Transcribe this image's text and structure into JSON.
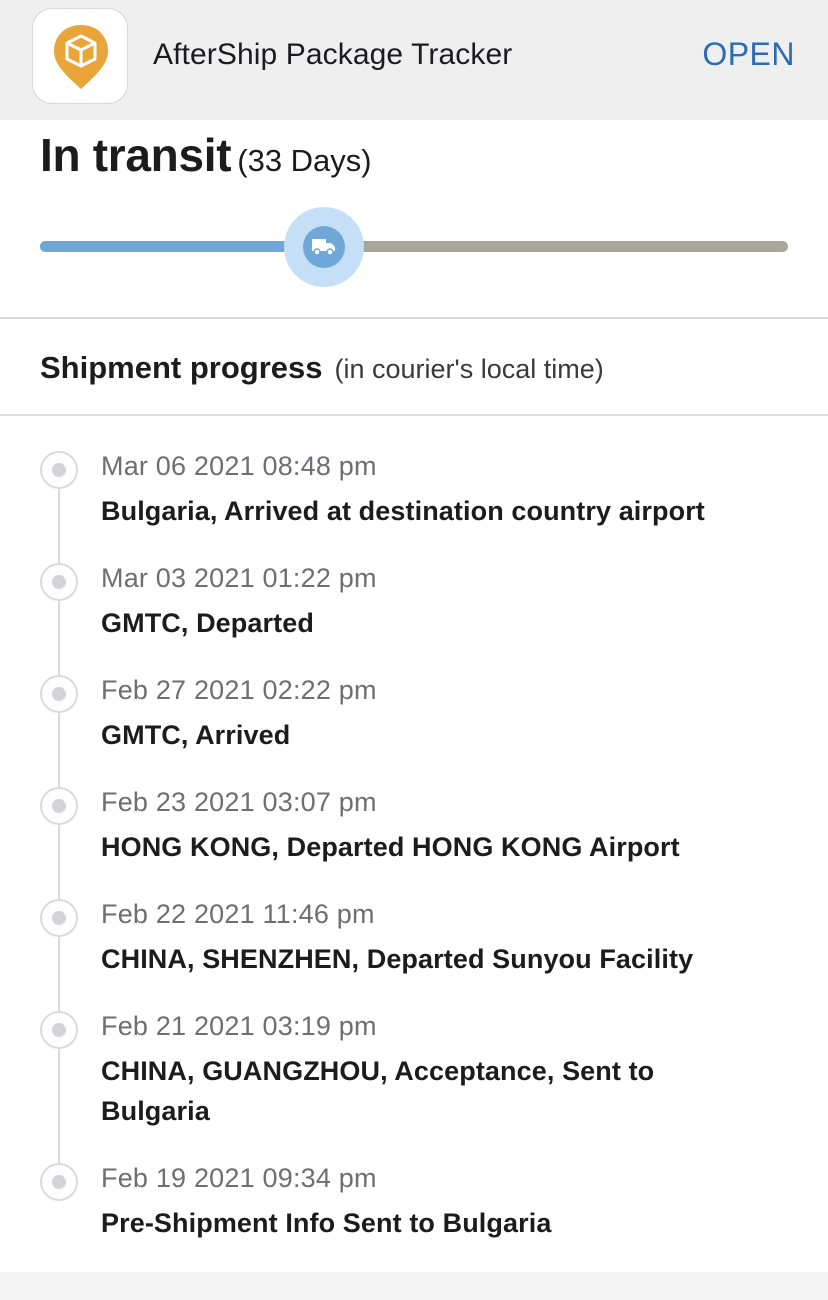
{
  "banner": {
    "app_name": "AfterShip Package Tracker",
    "open_label": "OPEN",
    "icon": "package-location-pin-icon",
    "accent_color": "#e9a53a",
    "open_color": "#2d6cb4"
  },
  "status": {
    "title": "In transit",
    "days": "(33 Days)",
    "progress_fraction": 0.38,
    "progress_icon": "truck-icon",
    "fill_color": "#6fa8d8",
    "track_color": "#a9a598"
  },
  "section": {
    "title": "Shipment progress",
    "subtitle": "(in courier's local time)"
  },
  "events": [
    {
      "time": "Mar 06 2021 08:48 pm",
      "desc": "Bulgaria, Arrived at destination country airport"
    },
    {
      "time": "Mar 03 2021 01:22 pm",
      "desc": "GMTC, Departed"
    },
    {
      "time": "Feb 27 2021 02:22 pm",
      "desc": "GMTC, Arrived"
    },
    {
      "time": "Feb 23 2021 03:07 pm",
      "desc": "HONG KONG, Departed HONG KONG Airport"
    },
    {
      "time": "Feb 22 2021 11:46 pm",
      "desc": "CHINA, SHENZHEN, Departed Sunyou Facility"
    },
    {
      "time": "Feb 21 2021 03:19 pm",
      "desc": "CHINA, GUANGZHOU, Acceptance, Sent to Bulgaria"
    },
    {
      "time": "Feb 19 2021 09:34 pm",
      "desc": "Pre-Shipment Info Sent to Bulgaria"
    }
  ]
}
